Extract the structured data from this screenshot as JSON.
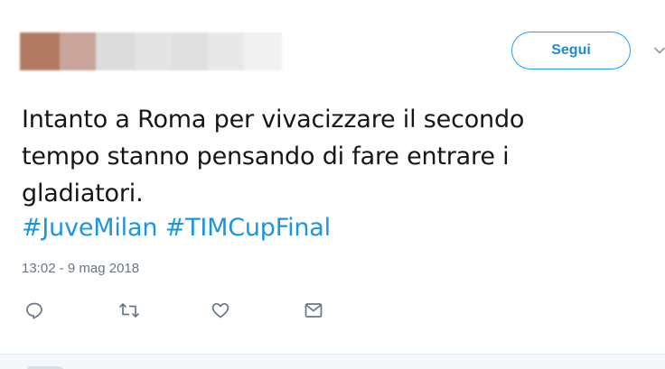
{
  "tweet": {
    "follow_label": "Segui",
    "text_lines": [
      "Intanto a Roma per vivacizzare il secondo",
      "tempo stanno pensando di fare entrare i",
      "gladiatori."
    ],
    "hashtags": [
      "#JuveMilan",
      "#TIMCupFinal"
    ],
    "timestamp": "13:02 - 9 mag 2018"
  },
  "colors": {
    "accent": "#1da1f2",
    "text": "#14171a",
    "muted": "#657786",
    "blur_swatches": [
      "#b27a62",
      "#c9a49a",
      "#dcdcdc",
      "#e4e4e4",
      "#e0e0e0",
      "#e8e8e8",
      "#ececec",
      "#f1f1f1"
    ]
  },
  "icons": {
    "reply": "reply-icon",
    "retweet": "retweet-icon",
    "like": "heart-icon",
    "message": "envelope-icon",
    "more": "chevron-down-icon"
  }
}
